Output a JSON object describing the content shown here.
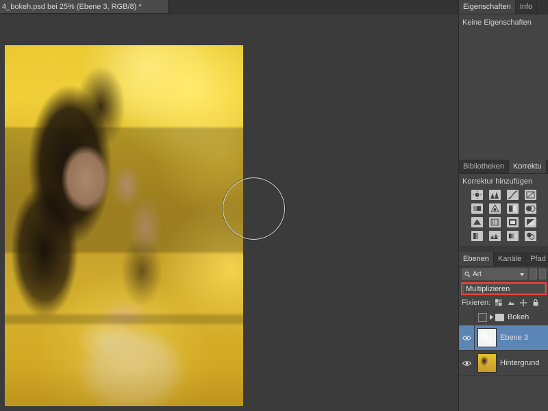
{
  "document": {
    "tab_title": "4_bokeh.psd bei 25% (Ebene 3, RGB/8) *"
  },
  "properties_panel": {
    "tabs": [
      {
        "label": "Eigenschaften",
        "active": true
      },
      {
        "label": "Info",
        "active": false
      }
    ],
    "empty_message": "Keine Eigenschaften"
  },
  "adjustments_panel": {
    "tabs": [
      {
        "label": "Bibliotheken",
        "active": false
      },
      {
        "label": "Korrektu",
        "active": true
      }
    ],
    "title": "Korrektur hinzufügen",
    "icons": [
      "brightness-contrast-icon",
      "levels-icon",
      "curves-icon",
      "exposure-icon",
      "vibrance-icon",
      "hue-saturation-icon",
      "color-balance-icon",
      "black-white-icon",
      "photo-filter-icon",
      "channel-mixer-icon",
      "color-lookup-icon",
      "invert-icon",
      "posterize-icon",
      "threshold-icon",
      "gradient-map-icon",
      "selective-color-icon"
    ]
  },
  "layers_panel": {
    "tabs": [
      {
        "label": "Ebenen",
        "active": true
      },
      {
        "label": "Kanäle",
        "active": false
      },
      {
        "label": "Pfad",
        "active": false
      }
    ],
    "filter": {
      "type_label": "Art",
      "search_icon": "search-icon"
    },
    "blend_mode": "Multiplizieren",
    "lock_label": "Fixieren:",
    "lock_icons": [
      "lock-transparency-icon",
      "lock-image-icon",
      "lock-position-icon",
      "lock-all-icon"
    ],
    "layers": [
      {
        "name": "Bokeh",
        "type": "group",
        "visible": false,
        "selected": false,
        "thumb": "folder"
      },
      {
        "name": "Ebene 3",
        "type": "layer",
        "visible": true,
        "selected": true,
        "thumb": "bokeh"
      },
      {
        "name": "Hintergrund",
        "type": "layer",
        "visible": true,
        "selected": false,
        "thumb": "portrait"
      }
    ]
  },
  "canvas": {
    "brush_cursor": "brush-cursor",
    "image_alt": "bokeh-portrait-image"
  },
  "colors": {
    "highlight_red": "#e8453c",
    "selection_blue": "#5b85b5",
    "panel_bg": "#444444",
    "app_bg": "#3a3a3a"
  }
}
